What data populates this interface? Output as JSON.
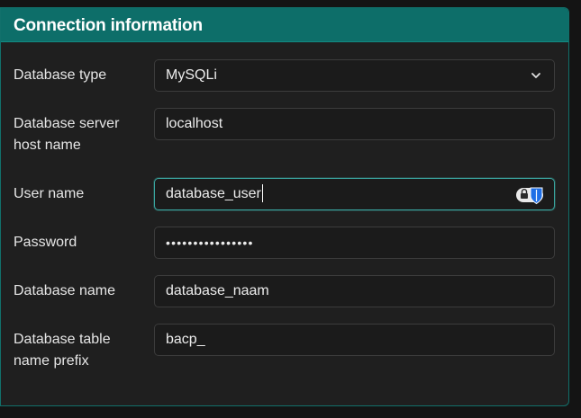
{
  "panel": {
    "title": "Connection information"
  },
  "fields": [
    {
      "key": "db_type",
      "label": "Database type",
      "value": "MySQLi",
      "type": "select"
    },
    {
      "key": "db_host",
      "label": "Database server host name",
      "value": "localhost",
      "type": "text"
    },
    {
      "key": "db_user",
      "label": "User name",
      "value": "database_user",
      "type": "text",
      "focused": true
    },
    {
      "key": "db_pass",
      "label": "Password",
      "value": "••••••••••••••••",
      "type": "password"
    },
    {
      "key": "db_name",
      "label": "Database name",
      "value": "database_naam",
      "type": "text"
    },
    {
      "key": "db_prefix",
      "label": "Database table name prefix",
      "value": "bacp_",
      "type": "text"
    }
  ],
  "icons": {
    "select_chevron": "chevron-down-icon",
    "password_manager": "password-manager-icon"
  },
  "colors": {
    "header_bg": "#0d6e69",
    "panel_border": "#11706b",
    "focus_border": "#3aa6a0",
    "password_manager_shield": "#1f6fe6"
  }
}
